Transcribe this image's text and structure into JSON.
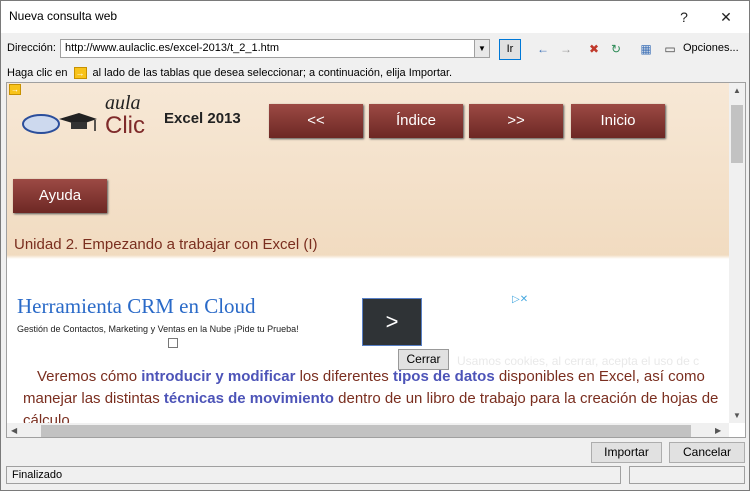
{
  "window": {
    "title": "Nueva consulta web",
    "help_glyph": "?",
    "close_glyph": "✕"
  },
  "address": {
    "label": "Dirección:",
    "url": "http://www.aulaclic.es/excel-2013/t_2_1.htm",
    "go_label": "Ir",
    "options_label": "Opciones..."
  },
  "hint": {
    "before": "Haga clic en",
    "after": "al lado de las tablas que desea seleccionar; a continuación, elija Importar."
  },
  "site": {
    "logo_word1": "aula",
    "logo_word2": "Clic",
    "title": "Excel 2013",
    "nav": [
      "<<",
      "Índice",
      ">>",
      "Inicio"
    ],
    "help_button": "Ayuda",
    "unit_title": "Unidad 2. Empezando a trabajar con Excel (I)"
  },
  "ad": {
    "title": "Herramienta CRM en Cloud",
    "subtitle": "Gestión de Contactos, Marketing y Ventas en la Nube ¡Pide tu Prueba!",
    "arrow": ">",
    "info": "▷✕"
  },
  "cookie": {
    "close_label": "Cerrar",
    "text": "Usamos cookies, al cerrar, acepta el uso de c"
  },
  "body": {
    "t1": "Veremos cómo ",
    "k1": "introducir y modificar",
    "t2": " los diferentes ",
    "k2": "tipos de datos",
    "t3": " disponibles en Excel, así como manejar las distintas ",
    "k3": "técnicas de movimiento",
    "t4": " dentro de un libro de trabajo para la creación de hojas de cálculo."
  },
  "footer": {
    "import_label": "Importar",
    "cancel_label": "Cancelar",
    "status": "Finalizado"
  },
  "colors": {
    "nav_button": "#7f3430",
    "unit_title": "#7a2e1f",
    "keyword": "#4d54b8",
    "ad_title": "#2a6ac8"
  }
}
